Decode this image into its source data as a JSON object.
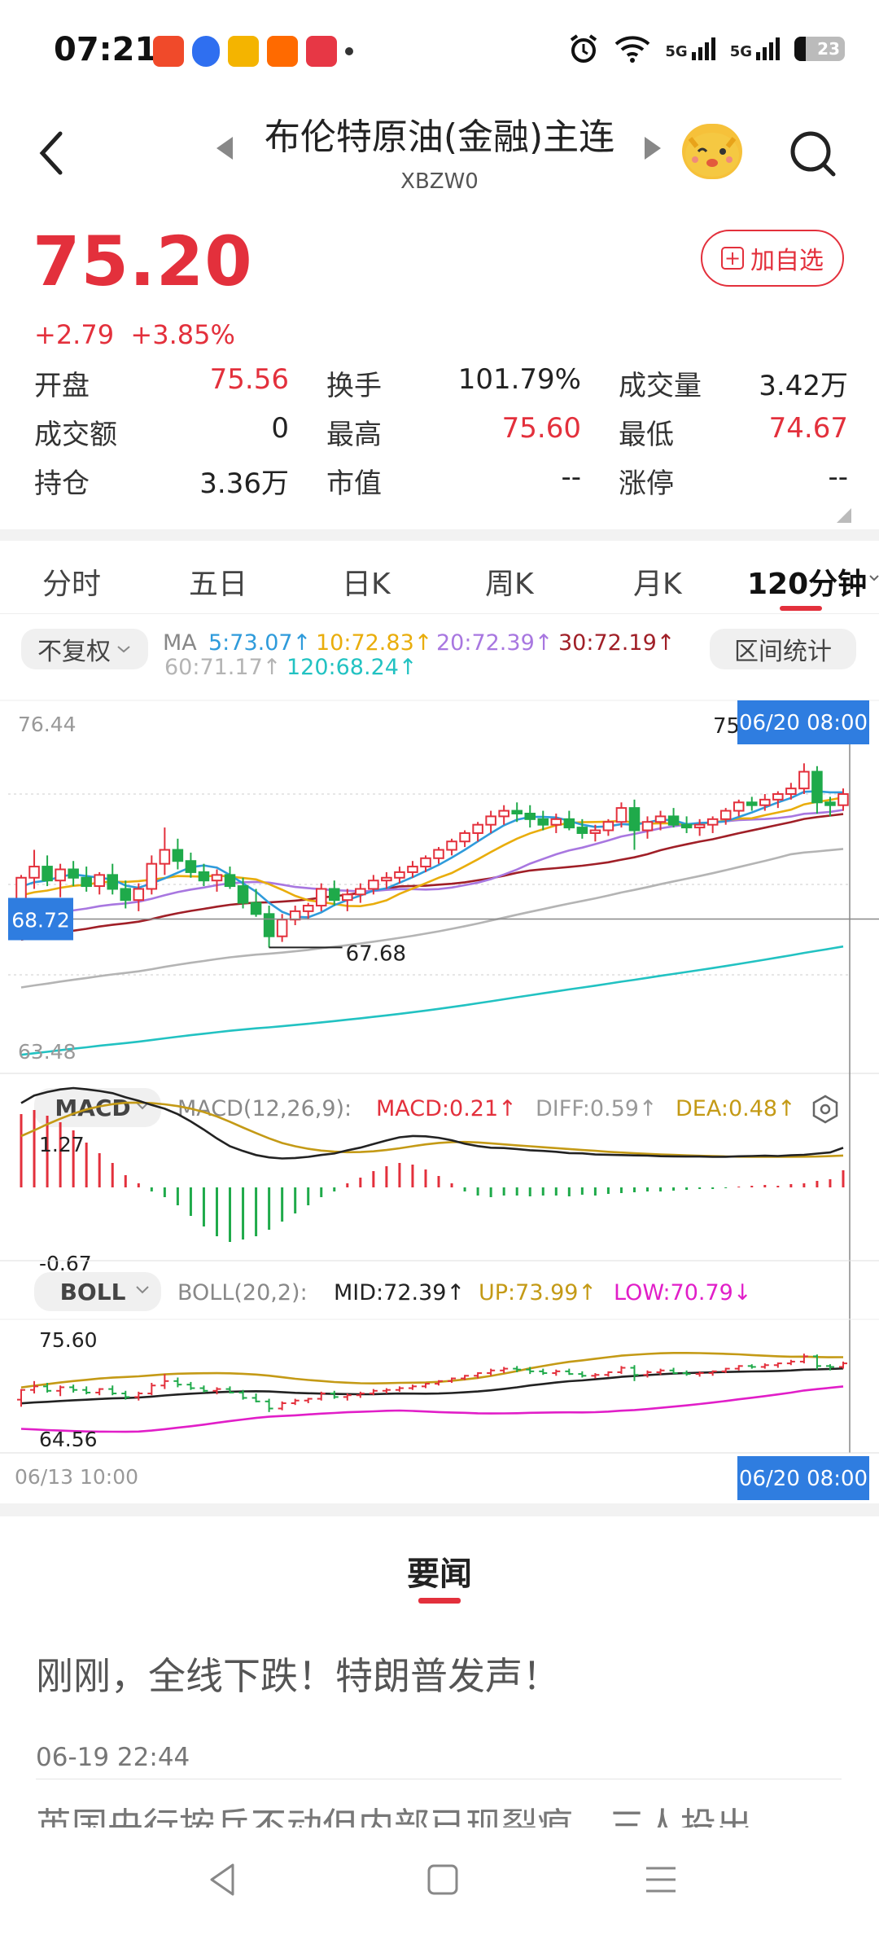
{
  "status_bar": {
    "time": "07:21",
    "net1": "5G",
    "net2": "5G",
    "battery": "23"
  },
  "header": {
    "title": "布伦特原油(金融)主连",
    "code": "XBZW0"
  },
  "quote": {
    "price": "75.20",
    "change": "+2.79",
    "change_pct": "+3.85%",
    "watch_label": "加自选",
    "stats": [
      [
        {
          "k": "开盘",
          "v": "75.56",
          "red": true
        },
        {
          "k": "换手",
          "v": "101.79%",
          "red": false
        },
        {
          "k": "成交量",
          "v": "3.42万",
          "red": false
        }
      ],
      [
        {
          "k": "成交额",
          "v": "0",
          "red": false
        },
        {
          "k": "最高",
          "v": "75.60",
          "red": true
        },
        {
          "k": "最低",
          "v": "74.67",
          "red": true
        }
      ],
      [
        {
          "k": "持仓",
          "v": "3.36万",
          "red": false
        },
        {
          "k": "市值",
          "v": "--",
          "red": false
        },
        {
          "k": "涨停",
          "v": "--",
          "red": false
        }
      ]
    ]
  },
  "tabs": [
    "分时",
    "五日",
    "日K",
    "周K",
    "月K",
    "120分钟"
  ],
  "active_tab": "120分钟",
  "ma_bar": {
    "adjust_label": "不复权",
    "range_label": "区间统计",
    "prefix": "MA",
    "items": [
      {
        "label": "5:73.07",
        "color": "#2f9bdb"
      },
      {
        "label": "10:72.83",
        "color": "#e9ad0c"
      },
      {
        "label": "20:72.39",
        "color": "#a877e0"
      },
      {
        "label": "30:72.19",
        "color": "#a01f27"
      },
      {
        "label": "60:71.17",
        "color": "#b4b4b4"
      },
      {
        "label": "120:68.24",
        "color": "#22c2c2"
      }
    ]
  },
  "chart_data": {
    "type": "candlestick",
    "interval": "120分钟",
    "x_start_label": "06/13 10:00",
    "cursor_label": "06/20 08:00",
    "price_axis": {
      "max_label": "76.44",
      "min_label": "63.48",
      "cursor_price": "68.72",
      "ylim": [
        63.48,
        76.44
      ]
    },
    "low_marker": "67.68",
    "cut_label": "75",
    "candles": [
      [
        69.1,
        70.3,
        68.3,
        70.2
      ],
      [
        70.2,
        71.2,
        69.8,
        70.6
      ],
      [
        70.6,
        71.0,
        69.9,
        70.1
      ],
      [
        70.1,
        70.7,
        69.5,
        70.5
      ],
      [
        70.5,
        70.8,
        69.9,
        70.2
      ],
      [
        70.2,
        70.6,
        69.7,
        69.9
      ],
      [
        69.9,
        70.4,
        69.6,
        70.3
      ],
      [
        70.3,
        70.7,
        69.6,
        69.8
      ],
      [
        69.8,
        70.1,
        69.1,
        69.4
      ],
      [
        69.4,
        70.0,
        69.0,
        69.8
      ],
      [
        69.8,
        71.0,
        69.6,
        70.7
      ],
      [
        70.7,
        72.0,
        70.3,
        71.2
      ],
      [
        71.2,
        71.6,
        70.5,
        70.8
      ],
      [
        70.8,
        71.1,
        70.2,
        70.4
      ],
      [
        70.4,
        70.7,
        69.9,
        70.1
      ],
      [
        70.1,
        70.5,
        69.7,
        70.3
      ],
      [
        70.3,
        70.6,
        69.8,
        69.9
      ],
      [
        69.9,
        70.2,
        69.1,
        69.3
      ],
      [
        69.3,
        69.8,
        68.8,
        68.9
      ],
      [
        68.9,
        69.2,
        67.7,
        68.1
      ],
      [
        68.1,
        68.9,
        67.9,
        68.7
      ],
      [
        68.7,
        69.2,
        68.5,
        69.0
      ],
      [
        69.0,
        69.3,
        68.7,
        69.2
      ],
      [
        69.2,
        70.0,
        69.0,
        69.8
      ],
      [
        69.8,
        70.1,
        69.2,
        69.4
      ],
      [
        69.4,
        69.8,
        69.0,
        69.6
      ],
      [
        69.6,
        70.0,
        69.3,
        69.8
      ],
      [
        69.8,
        70.3,
        69.6,
        70.1
      ],
      [
        70.1,
        70.4,
        69.8,
        70.2
      ],
      [
        70.2,
        70.6,
        70.0,
        70.4
      ],
      [
        70.4,
        70.8,
        70.2,
        70.6
      ],
      [
        70.6,
        71.0,
        70.4,
        70.9
      ],
      [
        70.9,
        71.3,
        70.7,
        71.2
      ],
      [
        71.2,
        71.6,
        71.0,
        71.5
      ],
      [
        71.5,
        71.9,
        71.3,
        71.8
      ],
      [
        71.8,
        72.2,
        71.5,
        72.1
      ],
      [
        72.1,
        72.6,
        71.8,
        72.4
      ],
      [
        72.4,
        72.8,
        72.1,
        72.6
      ],
      [
        72.6,
        72.9,
        72.2,
        72.5
      ],
      [
        72.5,
        72.8,
        72.0,
        72.3
      ],
      [
        72.3,
        72.6,
        71.9,
        72.1
      ],
      [
        72.1,
        72.5,
        71.8,
        72.3
      ],
      [
        72.3,
        72.6,
        71.9,
        72.0
      ],
      [
        72.0,
        72.3,
        71.6,
        71.8
      ],
      [
        71.8,
        72.1,
        71.5,
        71.9
      ],
      [
        71.9,
        72.3,
        71.7,
        72.2
      ],
      [
        72.2,
        72.9,
        72.0,
        72.7
      ],
      [
        72.7,
        73.0,
        71.2,
        71.9
      ],
      [
        71.9,
        72.4,
        71.6,
        72.2
      ],
      [
        72.2,
        72.6,
        71.9,
        72.4
      ],
      [
        72.4,
        72.7,
        72.0,
        72.1
      ],
      [
        72.1,
        72.4,
        71.8,
        72.0
      ],
      [
        72.0,
        72.3,
        71.7,
        72.1
      ],
      [
        72.1,
        72.4,
        71.8,
        72.3
      ],
      [
        72.3,
        72.7,
        72.1,
        72.6
      ],
      [
        72.6,
        73.0,
        72.4,
        72.9
      ],
      [
        72.9,
        73.1,
        72.6,
        72.8
      ],
      [
        72.8,
        73.2,
        72.6,
        73.0
      ],
      [
        73.0,
        73.3,
        72.7,
        73.2
      ],
      [
        73.2,
        73.6,
        73.0,
        73.4
      ],
      [
        73.4,
        74.3,
        73.2,
        74.0
      ],
      [
        74.0,
        74.2,
        72.5,
        72.9
      ],
      [
        72.9,
        73.1,
        72.4,
        72.8
      ],
      [
        72.8,
        73.4,
        72.6,
        73.2
      ]
    ],
    "ma_series": [
      {
        "name": "MA5",
        "value": 73.07,
        "color": "#2f9bdb"
      },
      {
        "name": "MA10",
        "value": 72.83,
        "color": "#e9ad0c"
      },
      {
        "name": "MA20",
        "value": 72.39,
        "color": "#a877e0"
      },
      {
        "name": "MA30",
        "value": 72.19,
        "color": "#a01f27"
      },
      {
        "name": "MA60",
        "value": 71.17,
        "color": "#b4b4b4"
      },
      {
        "name": "MA120",
        "value": 68.24,
        "color": "#22c2c2"
      }
    ],
    "macd": {
      "selector": "MACD",
      "params_label": "MACD(12,26,9):",
      "macd_label": "MACD:0.21",
      "diff_label": "DIFF:0.59",
      "dea_label": "DEA:0.48",
      "max_label": "1.27",
      "min_label": "-0.67",
      "hist": [
        0.9,
        0.95,
        0.88,
        0.8,
        0.7,
        0.55,
        0.42,
        0.3,
        0.15,
        0.05,
        -0.05,
        -0.12,
        -0.22,
        -0.35,
        -0.48,
        -0.6,
        -0.67,
        -0.64,
        -0.6,
        -0.52,
        -0.42,
        -0.32,
        -0.22,
        -0.12,
        -0.05,
        0.05,
        0.12,
        0.2,
        0.26,
        0.3,
        0.28,
        0.22,
        0.14,
        0.05,
        -0.05,
        -0.1,
        -0.12,
        -0.1,
        -0.1,
        -0.11,
        -0.1,
        -0.1,
        -0.11,
        -0.09,
        -0.1,
        -0.08,
        -0.07,
        -0.06,
        -0.05,
        -0.05,
        -0.04,
        -0.03,
        -0.02,
        -0.02,
        -0.01,
        0.01,
        0.02,
        0.03,
        0.02,
        0.04,
        0.05,
        0.08,
        0.1,
        0.21
      ]
    },
    "boll": {
      "selector": "BOLL",
      "params_label": "BOLL(20,2):",
      "mid_label": "MID:72.39",
      "up_label": "UP:73.99",
      "low_label": "LOW:70.79",
      "max_label": "75.60",
      "min_label": "64.56"
    }
  },
  "news": {
    "section_title": "要闻",
    "headline": "刚刚，全线下跌！特朗普发声！",
    "timestamp": "06-19 22:44",
    "headline2": "英国央行按兵不动但内部已现裂痕，三人投出"
  }
}
